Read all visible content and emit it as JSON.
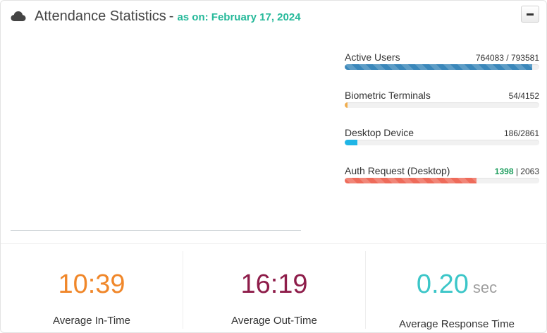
{
  "header": {
    "title": "Attendance Statistics",
    "separator": "-",
    "date_text": "as on: February 17, 2024",
    "cloud_icon": "cloud-icon",
    "collapse_icon": "minus-icon"
  },
  "progress": [
    {
      "label": "Active Users",
      "count": "764083 / 793581",
      "fraction": 0.963,
      "color": "#3a87ba",
      "striped": true
    },
    {
      "label": "Biometric Terminals",
      "count": "54/4152",
      "fraction": 0.013,
      "color": "#f0ad4e",
      "striped": false
    },
    {
      "label": "Desktop Device",
      "count": "186/2861",
      "fraction": 0.065,
      "color": "#1fb5e6",
      "striped": false
    },
    {
      "label": "Auth Request (Desktop)",
      "count_highlight": "1398",
      "count_sep": " | ",
      "count_rest": "2063",
      "fraction": 0.678,
      "color": "#ee6b5a",
      "striped": true
    }
  ],
  "stats": [
    {
      "value": "10:39",
      "unit": "",
      "label": "Average In-Time",
      "color": "#f0872a"
    },
    {
      "value": "16:19",
      "unit": "",
      "label": "Average Out-Time",
      "color": "#8e1d4a"
    },
    {
      "value": "0.20",
      "unit": "sec",
      "label": "Average Response Time",
      "color": "#3cc6c8"
    }
  ]
}
